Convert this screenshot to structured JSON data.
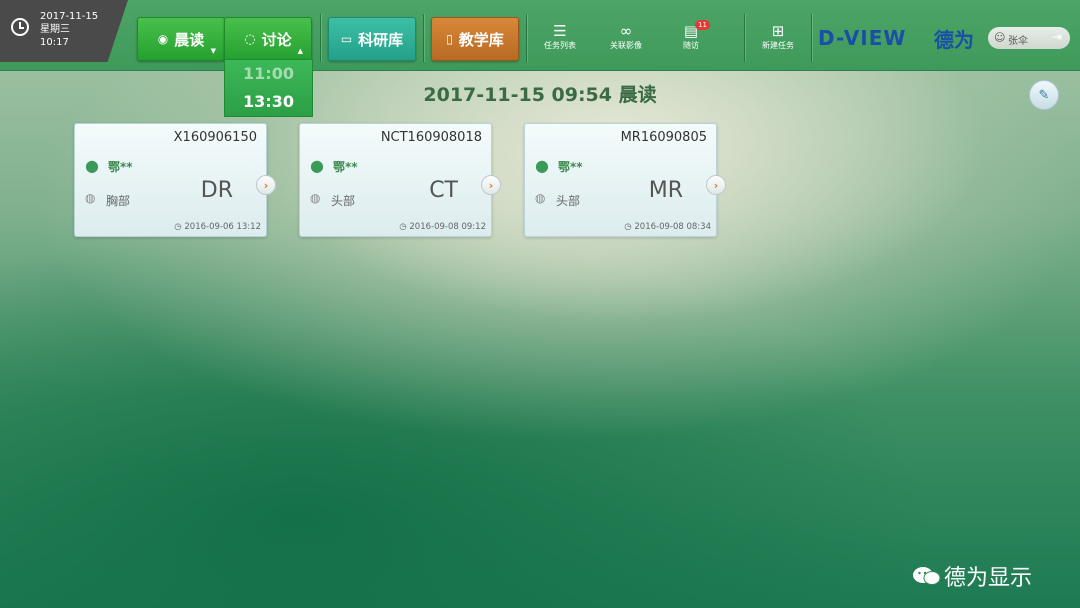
{
  "clock": {
    "date": "2017-11-15",
    "weekday": "星期三",
    "time": "10:17"
  },
  "nav": {
    "morning_read": "晨读",
    "discussion": "讨论",
    "research": "科研库",
    "teaching": "教学库"
  },
  "tools": {
    "task_list": "任务列表",
    "link_image": "关联影像",
    "followup": "随访",
    "followup_badge": "11",
    "new_task": "新建任务"
  },
  "brand": {
    "logo": "D-VIEW",
    "cn": "德为"
  },
  "user": {
    "name": "张伞"
  },
  "dropdown": {
    "options": [
      "11:00",
      "13:30"
    ],
    "selected": "13:30"
  },
  "page_title": "2017-11-15 09:54 晨读",
  "cards": [
    {
      "id": "X160906150",
      "patient": "鄂**",
      "body_part": "胸部",
      "modality": "DR",
      "datetime": "2016-09-06 13:12"
    },
    {
      "id": "NCT160908018",
      "patient": "鄂**",
      "body_part": "头部",
      "modality": "CT",
      "datetime": "2016-09-08 09:12"
    },
    {
      "id": "MR16090805",
      "patient": "鄂**",
      "body_part": "头部",
      "modality": "MR",
      "datetime": "2016-09-08 08:34"
    }
  ],
  "watermark": "德为显示",
  "colors": {
    "topbar": "#3e9a5a",
    "primary_green": "#25a02f",
    "teal": "#24a08a",
    "orange": "#b86a22",
    "brand_blue": "#1a4fa8"
  }
}
